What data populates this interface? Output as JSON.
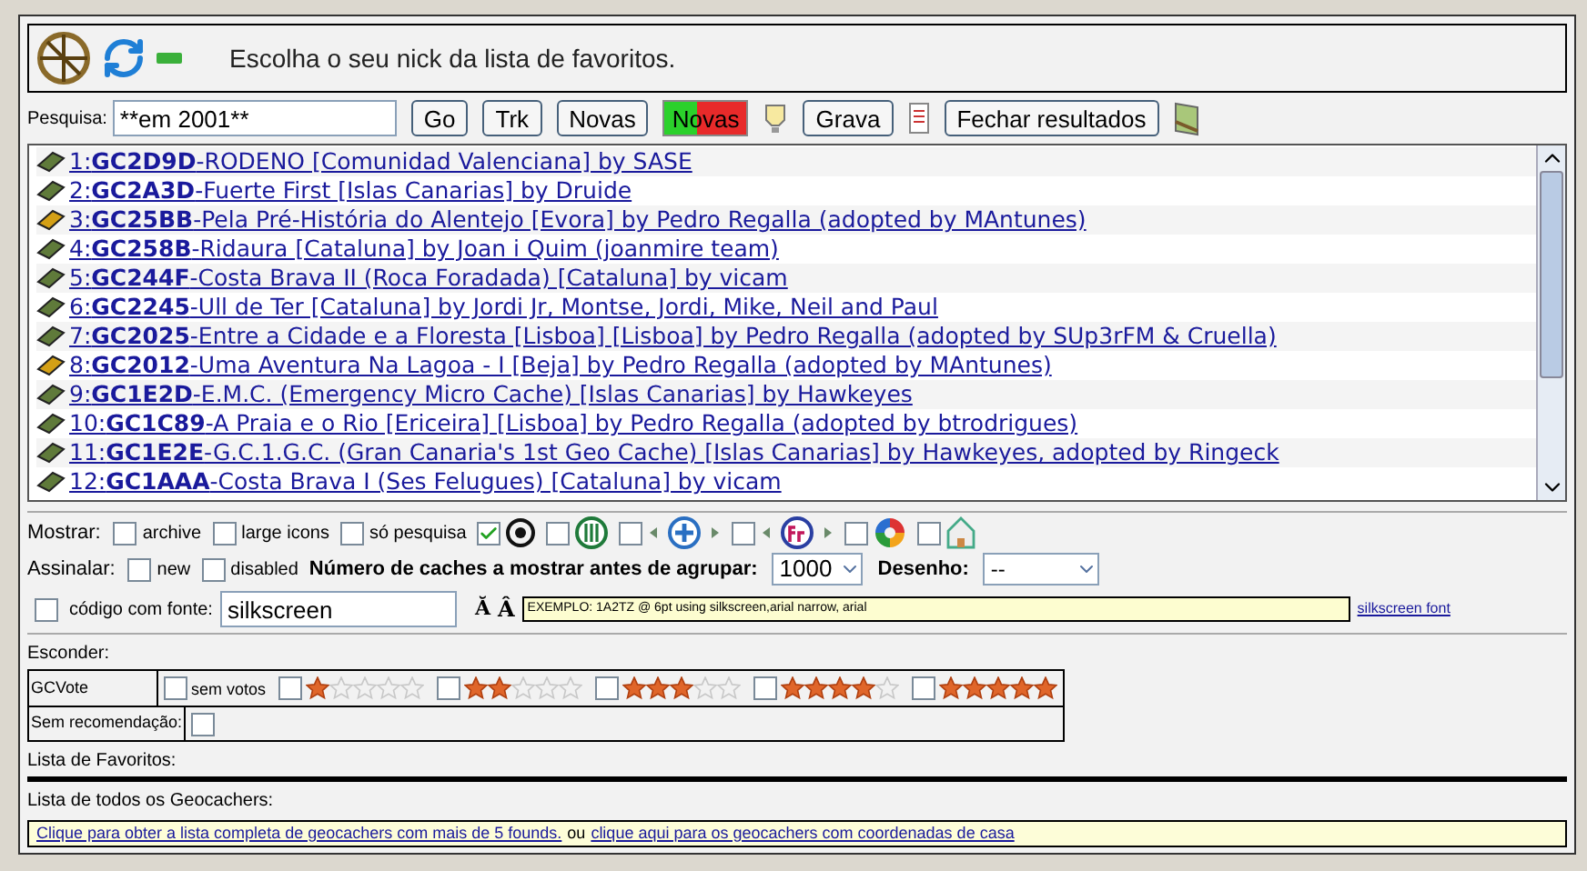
{
  "header": {
    "title": "Escolha o seu nick da lista de favoritos."
  },
  "search": {
    "label": "Pesquisa:",
    "value": "**em 2001**",
    "buttons": [
      {
        "label": "Go",
        "kind": "plain"
      },
      {
        "label": "Trk",
        "kind": "plain"
      },
      {
        "label": "Novas",
        "kind": "plain"
      },
      {
        "label": "Novas",
        "kind": "flag"
      },
      {
        "label": "Grava",
        "kind": "plain"
      },
      {
        "label": "Fechar resultados",
        "kind": "plain"
      }
    ]
  },
  "results": [
    {
      "number": "1:",
      "code": "GC2D9D",
      "title": "-RODENO [Comunidad Valenciana] by SASE",
      "kind": "traditional"
    },
    {
      "number": "2:",
      "code": "GC2A3D",
      "title": "-Fuerte First [Islas Canarias] by Druide",
      "kind": "traditional"
    },
    {
      "number": "3:",
      "code": "GC25BB",
      "title": "-Pela Pré-História do Alentejo [Evora] by Pedro Regalla (adopted by MAntunes)",
      "kind": "multi"
    },
    {
      "number": "4:",
      "code": "GC258B",
      "title": "-Ridaura [Cataluna] by Joan i Quim (joanmire team)",
      "kind": "traditional"
    },
    {
      "number": "5:",
      "code": "GC244F",
      "title": "-Costa Brava II (Roca Foradada) [Cataluna] by vicam",
      "kind": "traditional"
    },
    {
      "number": "6:",
      "code": "GC2245",
      "title": "-Ull de Ter [Cataluna] by Jordi Jr, Montse, Jordi, Mike, Neil and Paul",
      "kind": "traditional"
    },
    {
      "number": "7:",
      "code": "GC2025",
      "title": "-Entre a Cidade e a Floresta [Lisboa] [Lisboa] by Pedro Regalla (adopted by SUp3rFM & Cruella)",
      "kind": "traditional"
    },
    {
      "number": "8:",
      "code": "GC2012",
      "title": "-Uma Aventura Na Lagoa - I [Beja] by Pedro Regalla (adopted by MAntunes)",
      "kind": "multi"
    },
    {
      "number": "9:",
      "code": "GC1E2D",
      "title": "-E.M.C. (Emergency Micro Cache) [Islas Canarias] by Hawkeyes",
      "kind": "traditional"
    },
    {
      "number": "10:",
      "code": "GC1C89",
      "title": "-A Praia e o Rio [Ericeira] [Lisboa] by Pedro Regalla (adopted by btrodrigues)",
      "kind": "traditional"
    },
    {
      "number": "11:",
      "code": "GC1E2E",
      "title": "-G.C.1.G.C. (Gran Canaria's 1st Geo Cache) [Islas Canarias] by Hawkeyes, adopted by Ringeck",
      "kind": "traditional"
    },
    {
      "number": "12:",
      "code": "GC1AAA",
      "title": "-Costa Brava I (Ses Felugues) [Cataluna] by vicam",
      "kind": "traditional"
    }
  ],
  "show": {
    "label": "Mostrar:",
    "options": [
      {
        "label": "archive",
        "checked": false,
        "kind": "text"
      },
      {
        "label": "large icons",
        "checked": false,
        "kind": "text"
      },
      {
        "label": "só pesquisa",
        "checked": false,
        "kind": "text"
      },
      {
        "checked": true,
        "kind": "target"
      },
      {
        "checked": false,
        "kind": "restaurant"
      },
      {
        "checked": false,
        "kind": "plus"
      },
      {
        "checked": false,
        "kind": "fr"
      },
      {
        "checked": false,
        "kind": "pinwheel"
      },
      {
        "checked": false,
        "kind": "house"
      }
    ]
  },
  "mark": {
    "label": "Assinalar:",
    "options": [
      {
        "label": "new",
        "checked": false
      },
      {
        "label": "disabled",
        "checked": false
      }
    ],
    "count_label": "Número de caches a mostrar antes de agrupar:",
    "count_value": "1000",
    "drawing_label": "Desenho:",
    "drawing_value": "--"
  },
  "font": {
    "label": "código com fonte:",
    "checked": false,
    "value": "silkscreen",
    "size_buttons": [
      "Ă",
      "Â"
    ],
    "example": "EXEMPLO: 1A2TZ @ 6pt using silkscreen,arial narrow, arial",
    "link": "silkscreen font"
  },
  "hide": {
    "title": "Esconder:",
    "rows": [
      {
        "label": "GCVote",
        "options": [
          {
            "label": "sem votos",
            "checked": false
          },
          {
            "stars": 1,
            "checked": false
          },
          {
            "stars": 2,
            "checked": false
          },
          {
            "stars": 3,
            "checked": false
          },
          {
            "stars": 4,
            "checked": false
          },
          {
            "stars": 5,
            "checked": false
          }
        ]
      },
      {
        "label": "Sem recomendação:",
        "options": [
          {
            "checked": false
          }
        ]
      }
    ]
  },
  "favorites": {
    "title": "Lista de Favoritos:"
  },
  "all_geocachers": {
    "title": "Lista de todos os Geocachers:",
    "link_1": "Clique para obter a lista completa de geocachers com mais de 5 founds.",
    "separator": "ou",
    "link_2": "clique aqui para os geocachers com coordenadas de casa"
  }
}
